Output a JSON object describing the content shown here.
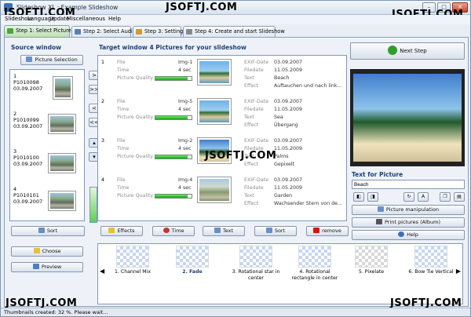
{
  "window": {
    "title": "Slideshow XL : Example Slideshow",
    "watermark": "JSOFTJ.COM"
  },
  "menu": [
    "Slideshow",
    "Language",
    "Update",
    "Miscellaneous",
    "Help"
  ],
  "tabs": [
    "Step 1: Select Pictures",
    "Step 2: Select Audio",
    "Step 3: Settings",
    "Step 4: Create and start Slideshow"
  ],
  "source": {
    "header": "Source window",
    "picture_selection": "Picture Selection",
    "items": [
      {
        "num": "1",
        "name": "P1010098",
        "date": "03.09.2007",
        "img": "rock"
      },
      {
        "num": "2",
        "name": "P1010099",
        "date": "03.09.2007",
        "img": "rock"
      },
      {
        "num": "3",
        "name": "P1010100",
        "date": "03.09.2007",
        "img": "rock"
      },
      {
        "num": "4",
        "name": "P1010101",
        "date": "03.09.2007",
        "img": "rock"
      }
    ],
    "sort": "Sort",
    "choose": "Choose",
    "preview": "Preview"
  },
  "target": {
    "header": "Target window 4 Pictures for your slideshow",
    "labels": {
      "file": "File",
      "time": "Time",
      "quality": "Picture Quality",
      "exif": "EXIF-Date",
      "filedate": "Filedate",
      "text": "Text",
      "effect": "Effect"
    },
    "items": [
      {
        "num": "1",
        "file": "Img-1",
        "time": "4 sec",
        "quality": 0.9,
        "exif": "03.09.2007",
        "filedate": "11.05.2009",
        "text": "Beach",
        "effect": "Auftauchen und nach link...",
        "img": "beach"
      },
      {
        "num": "2",
        "file": "Img-5",
        "time": "4 sec",
        "quality": 0.9,
        "exif": "03.09.2007",
        "filedate": "11.05.2009",
        "text": "Sea",
        "effect": "Übergang",
        "img": "beach"
      },
      {
        "num": "3",
        "file": "Img-2",
        "time": "4 sec",
        "quality": 0.9,
        "exif": "03.09.2007",
        "filedate": "11.05.2009",
        "text": "Palms",
        "effect": "Gepixelt",
        "img": "palm"
      },
      {
        "num": "4",
        "file": "Img-4",
        "time": "4 sec",
        "quality": 0.9,
        "exif": "03.09.2007",
        "filedate": "11.05.2009",
        "text": "Garden",
        "effect": "Wachsender Stern von de...",
        "img": "garden"
      }
    ],
    "buttons": {
      "effects": "Effects",
      "time": "Time",
      "text": "Text",
      "sort": "Sort",
      "remove": "remove"
    }
  },
  "right": {
    "next_step": "Next Step",
    "text_for_picture": "Text for Picture",
    "text_value": "Beach",
    "picture_manipulation": "Picture manipulation",
    "print": "Print pictures (Album)",
    "help": "Help"
  },
  "transitions": [
    {
      "label": "1. Channel Mix",
      "selected": false
    },
    {
      "label": "2. Fade",
      "selected": true
    },
    {
      "label": "3. Rotational star in center",
      "selected": false
    },
    {
      "label": "4. Rotational rectangle in center",
      "selected": false
    },
    {
      "label": "5. Pixelate",
      "selected": false
    },
    {
      "label": "6. Bow Tie Vertical",
      "selected": false
    }
  ],
  "status": "Thumbnails created: 32 %. Please wait..."
}
